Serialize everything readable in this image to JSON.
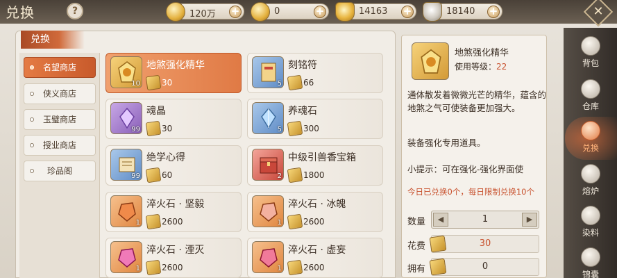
{
  "header": {
    "title": "兑换",
    "help_label": "?",
    "resources": [
      {
        "icon": "copper-coin-icon",
        "value": "120万"
      },
      {
        "icon": "gold-coin-icon",
        "value": "0"
      },
      {
        "icon": "gold-ingot-icon",
        "value": "14163"
      },
      {
        "icon": "silver-ingot-icon",
        "value": "18140"
      }
    ],
    "plus_label": "+",
    "close_label": "✕"
  },
  "panel": {
    "tab_label": "兑换"
  },
  "sidebar": {
    "items": [
      {
        "label": "名望商店",
        "active": true
      },
      {
        "label": "侠义商店",
        "active": false
      },
      {
        "label": "玉璧商店",
        "active": false
      },
      {
        "label": "授业商店",
        "active": false
      },
      {
        "label": "珍品阁",
        "active": false
      }
    ]
  },
  "items": [
    {
      "name": "地煞强化精华",
      "qty": "10",
      "cost": "30",
      "color": "gold",
      "selected": true
    },
    {
      "name": "刻铭符",
      "qty": "5",
      "cost": "66",
      "color": "blue",
      "selected": false
    },
    {
      "name": "魂晶",
      "qty": "99",
      "cost": "30",
      "color": "purple",
      "selected": false
    },
    {
      "name": "养魂石",
      "qty": "5",
      "cost": "300",
      "color": "blue",
      "selected": false
    },
    {
      "name": "绝学心得",
      "qty": "99",
      "cost": "60",
      "color": "blue",
      "selected": false
    },
    {
      "name": "中级引兽香宝箱",
      "qty": "2",
      "cost": "1800",
      "color": "red",
      "selected": false
    },
    {
      "name": "淬火石 · 坚毅",
      "qty": "1",
      "cost": "2600",
      "color": "orange",
      "selected": false
    },
    {
      "name": "淬火石 · 冰魄",
      "qty": "1",
      "cost": "2600",
      "color": "orange",
      "selected": false
    },
    {
      "name": "淬火石 · 湮灭",
      "qty": "1",
      "cost": "2600",
      "color": "orange",
      "selected": false
    },
    {
      "name": "淬火石 · 虚妄",
      "qty": "1",
      "cost": "2600",
      "color": "orange",
      "selected": false
    }
  ],
  "detail": {
    "name": "地煞强化精华",
    "level_label": "使用等级：",
    "level_value": "22",
    "description": "通体散发着微微光芒的精华，蕴含的地煞之气可使装备更加强大。",
    "usage": "装备强化专用道具。",
    "tip": "小提示：可在强化-强化界面使",
    "limit": "今日已兑换0个，每日限制兑换10个",
    "quantity_label": "数量",
    "quantity_value": "1",
    "dec_label": "◀",
    "inc_label": "▶",
    "cost_label": "花费",
    "cost_value": "30",
    "owned_label": "拥有",
    "owned_value": "0"
  },
  "nav": [
    {
      "label": "背包",
      "icon": "bag-icon",
      "active": false
    },
    {
      "label": "仓库",
      "icon": "warehouse-icon",
      "active": false
    },
    {
      "label": "兑换",
      "icon": "exchange-icon",
      "active": true
    },
    {
      "label": "熔炉",
      "icon": "furnace-icon",
      "active": false
    },
    {
      "label": "染料",
      "icon": "dye-icon",
      "active": false
    },
    {
      "label": "锦囊",
      "icon": "pouch-icon",
      "active": false
    }
  ]
}
